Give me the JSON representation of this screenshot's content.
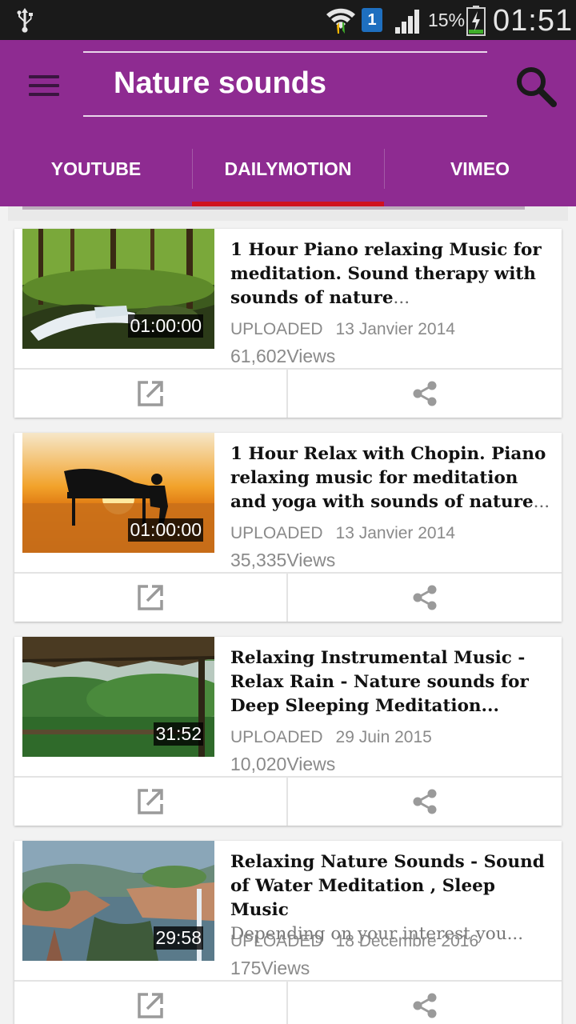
{
  "status_bar": {
    "battery_percent": "15%",
    "time": "01:51",
    "sim_slot": "1",
    "icons": [
      "usb-icon",
      "wifi-icon",
      "sim-icon",
      "signal-icon",
      "battery-charging-icon"
    ]
  },
  "app_bar": {
    "title": "Nature sounds",
    "background_color": "#8e2b91",
    "menu_icon": "hamburger-menu-icon",
    "search_icon": "search-icon"
  },
  "tabs": {
    "items": [
      {
        "label": "YOUTUBE"
      },
      {
        "label": "DAILYMOTION"
      },
      {
        "label": "VIMEO"
      }
    ],
    "selected": "DAILYMOTION",
    "indicator_color": "#d0101f"
  },
  "videos": [
    {
      "title": "1 Hour Piano relaxing Music for meditation. Sound therapy with sounds of nature",
      "ellipsis": "...",
      "description": "",
      "duration": "01:00:00",
      "uploaded_label": "UPLOADED",
      "uploaded_date": "13 Janvier 2014",
      "views": "61,602Views",
      "thumbnail": "forest-waterfall"
    },
    {
      "title": "1 Hour Relax with Chopin. Piano relaxing music for meditation and yoga with sounds of nature",
      "ellipsis": "...",
      "description": "",
      "duration": "01:00:00",
      "uploaded_label": "UPLOADED",
      "uploaded_date": "13 Janvier 2014",
      "views": "35,335Views",
      "thumbnail": "piano-sunset"
    },
    {
      "title": "Relaxing Instrumental Music - Relax Rain - Nature sounds for Deep Sleeping Meditation...",
      "ellipsis": "",
      "description": "",
      "duration": "31:52",
      "uploaded_label": "UPLOADED",
      "uploaded_date": "29 Juin 2015",
      "views": "10,020Views",
      "thumbnail": "rainforest-hut"
    },
    {
      "title": "Relaxing Nature Sounds - Sound of Water Meditation , Sleep Music",
      "ellipsis": "",
      "description": "Depending on your interest you...",
      "duration": "29:58",
      "uploaded_label": "UPLOADED",
      "uploaded_date": "18 Décembre 2016",
      "views": "175Views",
      "thumbnail": "fantasy-canyon"
    }
  ],
  "card_actions": {
    "open_icon": "open-external-icon",
    "share_icon": "share-icon"
  }
}
